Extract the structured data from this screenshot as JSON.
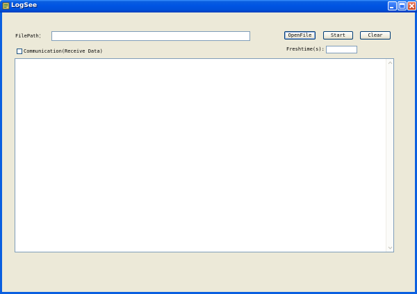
{
  "window": {
    "title": "LogSee",
    "accent": "#0054e3",
    "face": "#ece9d8"
  },
  "form": {
    "filepath_label": "FilePath：",
    "filepath_value": "",
    "communication_label": "Communication(Receive Data)",
    "communication_checked": false,
    "freshtime_label": "Freshtime(s):",
    "freshtime_value": ""
  },
  "buttons": {
    "open_file": "OpenFile",
    "start": "Start",
    "clear": "Clear"
  },
  "log": {
    "content": ""
  }
}
